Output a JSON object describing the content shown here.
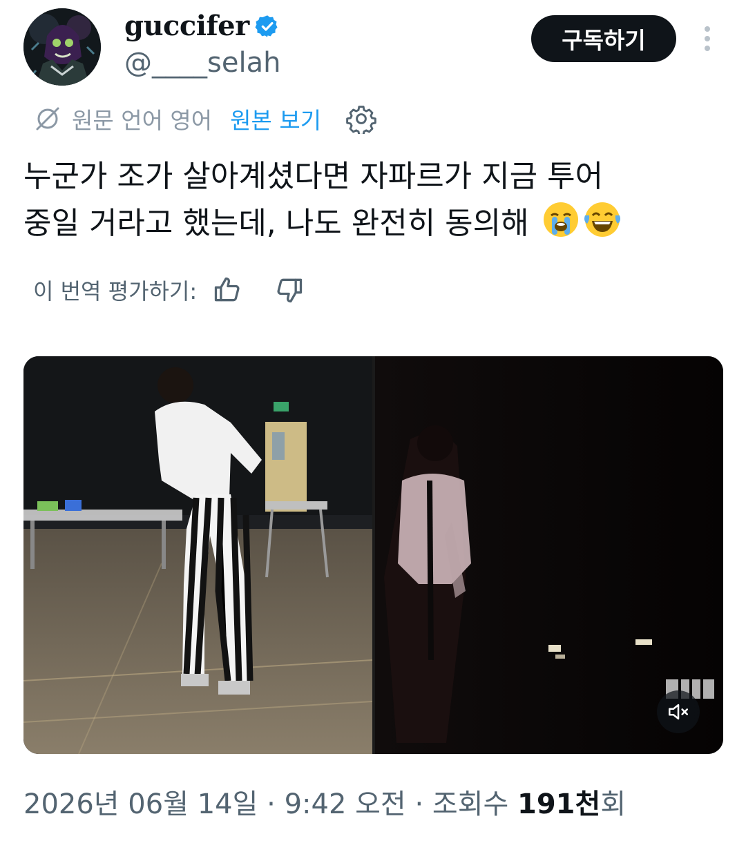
{
  "author": {
    "display_name": "guccifer",
    "handle": "@____selah",
    "verified": true,
    "avatar_icon": "avatar-image"
  },
  "header": {
    "subscribe_label": "구독하기",
    "more_icon": "more-vertical-icon"
  },
  "translation": {
    "icon": "translate-icon",
    "original_language": "원문 언어 영어",
    "view_original": "원본 보기",
    "settings_icon": "gear-icon"
  },
  "tweet": {
    "line1": "누군가 조가 살아계셨다면 자파르가 지금 투어",
    "line2": "중일 거라고 했는데, 나도 완전히 동의해",
    "emojis": [
      "loudly-crying-face",
      "face-with-tears-of-joy"
    ]
  },
  "rating": {
    "label": "이 번역 평가하기:",
    "up_icon": "thumbs-up-icon",
    "down_icon": "thumbs-down-icon"
  },
  "media": {
    "type": "video",
    "mute_icon": "speaker-muted-icon",
    "watermark": "MTV"
  },
  "meta": {
    "date": "2026년 06월 14일",
    "separator1": " · ",
    "time": "9:42 오전",
    "separator2": " · ",
    "views_label": "조회수 ",
    "views_count": "191천",
    "views_suffix": "회"
  },
  "colors": {
    "text_primary": "#0f1419",
    "text_secondary": "#536471",
    "link": "#1d9bf0",
    "verified": "#1d9bf0",
    "button_bg": "#0f1419"
  }
}
